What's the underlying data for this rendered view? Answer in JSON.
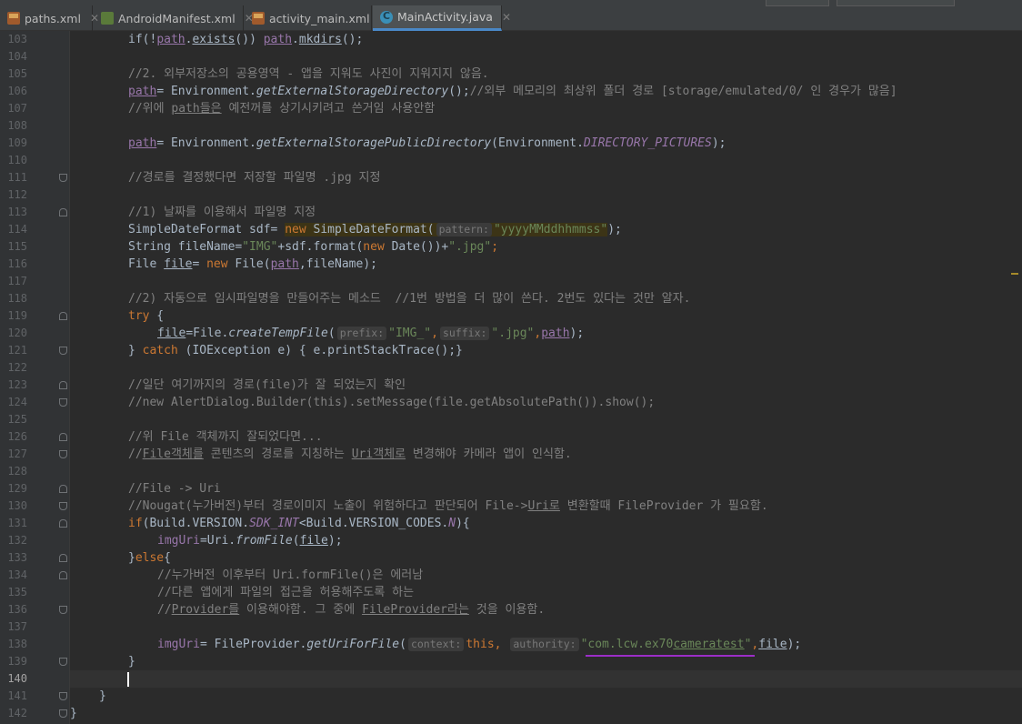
{
  "tabs": [
    {
      "label": "paths.xml",
      "icon": "xml-file-icon",
      "active": false
    },
    {
      "label": "AndroidManifest.xml",
      "icon": "manifest-file-icon",
      "active": false
    },
    {
      "label": "activity_main.xml",
      "icon": "xml-file-icon",
      "active": false
    },
    {
      "label": "MainActivity.java",
      "icon": "java-class-icon",
      "active": true
    }
  ],
  "close_glyph": "✕",
  "editor": {
    "current_line": "140",
    "lines": {
      "103": "103",
      "104": "104",
      "105": "105",
      "106": "106",
      "107": "107",
      "108": "108",
      "109": "109",
      "110": "110",
      "111": "111",
      "112": "112",
      "113": "113",
      "114": "114",
      "115": "115",
      "116": "116",
      "117": "117",
      "118": "118",
      "119": "119",
      "120": "120",
      "121": "121",
      "122": "122",
      "123": "123",
      "124": "124",
      "125": "125",
      "126": "126",
      "127": "127",
      "128": "128",
      "129": "129",
      "130": "130",
      "131": "131",
      "132": "132",
      "133": "133",
      "134": "134",
      "135": "135",
      "136": "136",
      "137": "137",
      "138": "138",
      "139": "139",
      "140": "140",
      "141": "141",
      "142": "142"
    },
    "code": {
      "l103": {
        "a": "if(!",
        "b": "path",
        "c": ".",
        "d": "exists",
        "e": "()) ",
        "f": "path",
        "g": ".",
        "h": "mkdirs",
        "i": "();"
      },
      "l105": "//2. 외부저장소의 공용영역 - 앱을 지워도 사진이 지워지지 않음.",
      "l106": {
        "a": "path",
        "b": "= Environment.",
        "c": "getExternalStorageDirectory",
        "d": "();",
        "e": "//외부 메모리의 최상위 폴더 경로 [storage/emulated/0/ 인 경우가 많음]"
      },
      "l107": {
        "a": "//위에 ",
        "b": "path들은",
        "c": " 예전꺼를 상기시키려고 쓴거임 사용안함"
      },
      "l109": {
        "a": "path",
        "b": "= Environment.",
        "c": "getExternalStoragePublicDirectory",
        "d": "(Environment.",
        "e": "DIRECTORY_PICTURES",
        "f": ");"
      },
      "l111": "//경로를 결정했다면 저장할 파일명 .jpg 지정",
      "l113": "//1) 날짜를 이용해서 파일명 지정",
      "l114": {
        "a": "SimpleDateFormat sdf= ",
        "b": "new",
        "c": " SimpleDateFormat(",
        "hint": "pattern:",
        "d": "\"yyyyMMddhhmmss\"",
        "e": ");"
      },
      "l115": {
        "a": "String fileName=",
        "b": "\"IMG\"",
        "c": "+sdf.format(",
        "d": "new",
        "e": " Date())+",
        "f": "\".jpg\"",
        "g": ";"
      },
      "l116": {
        "a": "File ",
        "b": "file",
        "c": "= ",
        "d": "new",
        "e": " File(",
        "f": "path",
        "g": ",fileName);"
      },
      "l118": "//2) 자동으로 임시파일명을 만들어주는 메소드  //1번 방법을 더 많이 쓴다. 2번도 있다는 것만 알자.",
      "l119": {
        "a": "try",
        "b": " {"
      },
      "l120": {
        "a": "file",
        "b": "=File.",
        "c": "createTempFile",
        "d": "(",
        "hint1": "prefix:",
        "e": "\"IMG_\"",
        "f": ",",
        "hint2": "suffix:",
        "g": "\".jpg\"",
        "h": ",",
        "i": "path",
        "j": ");"
      },
      "l121": {
        "a": "} ",
        "b": "catch",
        "c": " (IOException e) { e.printStackTrace();}"
      },
      "l123": "//일단 여기까지의 경로(file)가 잘 되었는지 확인",
      "l124": "//new AlertDialog.Builder(this).setMessage(file.getAbsolutePath()).show();",
      "l126": "//위 File 객체까지 잘되었다면...",
      "l127": {
        "a": "//",
        "b": "File객체를",
        "c": " 콘텐츠의 경로를 지칭하는 ",
        "d": "Uri객체로",
        "e": " 변경해야 카메라 앱이 인식함."
      },
      "l129": "//File -> Uri",
      "l130": {
        "a": "//Nougat(누가버전)부터 경로이미지 노출이 위험하다고 판단되어 File->",
        "b": "Uri로",
        "c": " 변환할때 FileProvider 가 필요함."
      },
      "l131": {
        "a": "if",
        "b": "(Build.VERSION.",
        "c": "SDK_INT",
        "d": "<Build.VERSION_CODES.",
        "e": "N",
        "f": "){"
      },
      "l132": {
        "a": "imgUri",
        "b": "=Uri.",
        "c": "fromFile",
        "d": "(",
        "e": "file",
        "f": ");"
      },
      "l133": {
        "a": "}",
        "b": "else",
        "c": "{"
      },
      "l134": "//누가버전 이후부터 Uri.formFile()은 에러남",
      "l135": "//다른 앱에게 파일의 접근을 허용해주도록 하는",
      "l136": {
        "a": "//",
        "b": "Provider를",
        "c": " 이용해야함. 그 중에 ",
        "d": "FileProvider라는",
        "e": " 것을 이용함."
      },
      "l138": {
        "a": "imgUri",
        "b": "= FileProvider.",
        "c": "getUriForFile",
        "d": "(",
        "hint1": "context:",
        "e": "this",
        "f": ", ",
        "hint2": "authority:",
        "g": "\"com.lcw.ex70",
        "h": "cameratest",
        "i": "\"",
        "j": ",",
        "k": "file",
        "l": ");"
      },
      "l139": "}",
      "l141": "}",
      "l142": "}"
    }
  },
  "colors": {
    "background": "#2b2b2b",
    "gutter": "#313335",
    "keyword": "#cc7832",
    "string": "#6a8759",
    "comment": "#808080",
    "field": "#9876aa",
    "text": "#a9b7c6",
    "tab_accent": "#4a88c7"
  }
}
